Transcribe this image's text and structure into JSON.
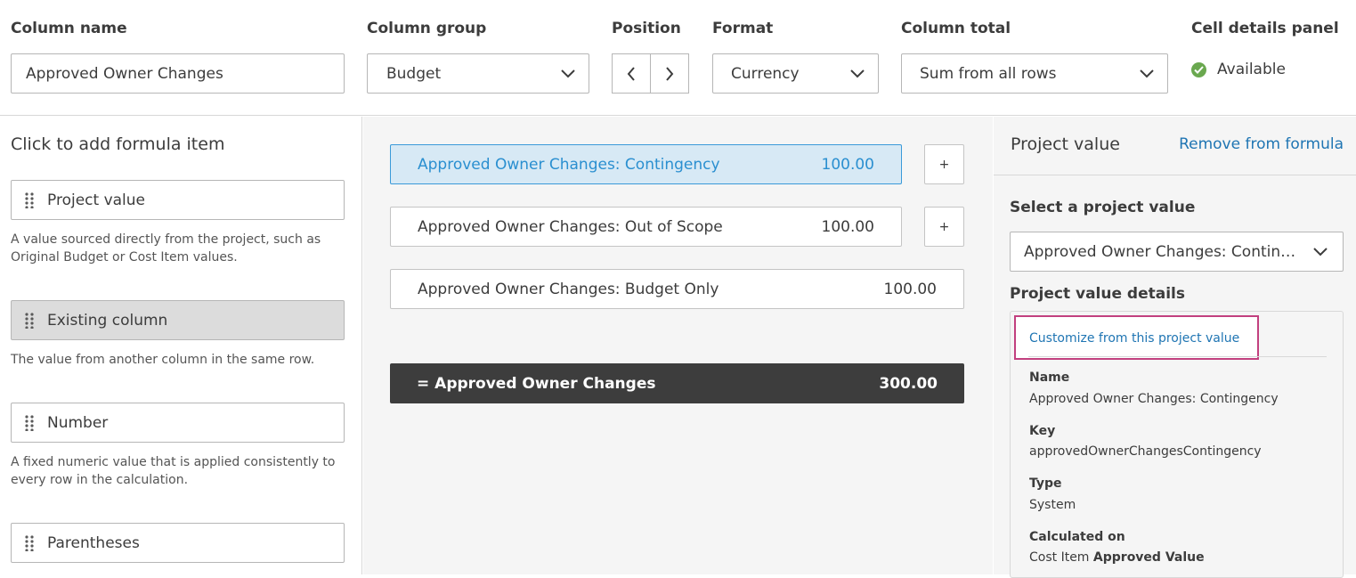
{
  "header": {
    "column_name": {
      "label": "Column name",
      "value": "Approved Owner Changes"
    },
    "column_group": {
      "label": "Column group",
      "value": "Budget"
    },
    "position": {
      "label": "Position"
    },
    "format": {
      "label": "Format",
      "value": "Currency"
    },
    "column_total": {
      "label": "Column total",
      "value": "Sum from all rows"
    },
    "cell_details_panel": {
      "label": "Cell details panel",
      "status": "Available"
    }
  },
  "formula_items": {
    "title": "Click to add formula item",
    "items": [
      {
        "label": "Project value",
        "description": "A value sourced directly from the project, such as Original Budget or Cost Item values."
      },
      {
        "label": "Existing column",
        "description": "The value from another column in the same row."
      },
      {
        "label": "Number",
        "description": "A fixed numeric value that is applied consistently to every row in the calculation."
      },
      {
        "label": "Parentheses",
        "description": ""
      }
    ]
  },
  "formula": {
    "rows": [
      {
        "label": "Approved Owner Changes: Contingency",
        "value": "100.00",
        "plus": "+"
      },
      {
        "label": "Approved Owner Changes: Out of Scope",
        "value": "100.00",
        "plus": "+"
      },
      {
        "label": "Approved Owner Changes: Budget Only",
        "value": "100.00"
      }
    ],
    "total": {
      "label": "= Approved Owner Changes",
      "value": "300.00"
    }
  },
  "details_panel": {
    "title": "Project value",
    "remove_link": "Remove from formula",
    "select_label": "Select a project value",
    "select_value": "Approved Owner Changes: Conting...",
    "details_label": "Project value details",
    "customize_link": "Customize from this project value",
    "fields": {
      "name_key": "Name",
      "name_value": "Approved Owner Changes: Contingency",
      "key_key": "Key",
      "key_value": "approvedOwnerChangesContingency",
      "type_key": "Type",
      "type_value": "System",
      "calc_key": "Calculated on",
      "calc_value_prefix": "Cost Item",
      "calc_value_bold": "Approved Value"
    }
  },
  "colors": {
    "active_row_bg": "#d7e9f5",
    "active_row_text": "#2a8fd0",
    "link": "#1f75b3",
    "available": "#6aa84f",
    "highlight_box": "#c2407f",
    "total_bg": "#3d3d3d"
  }
}
